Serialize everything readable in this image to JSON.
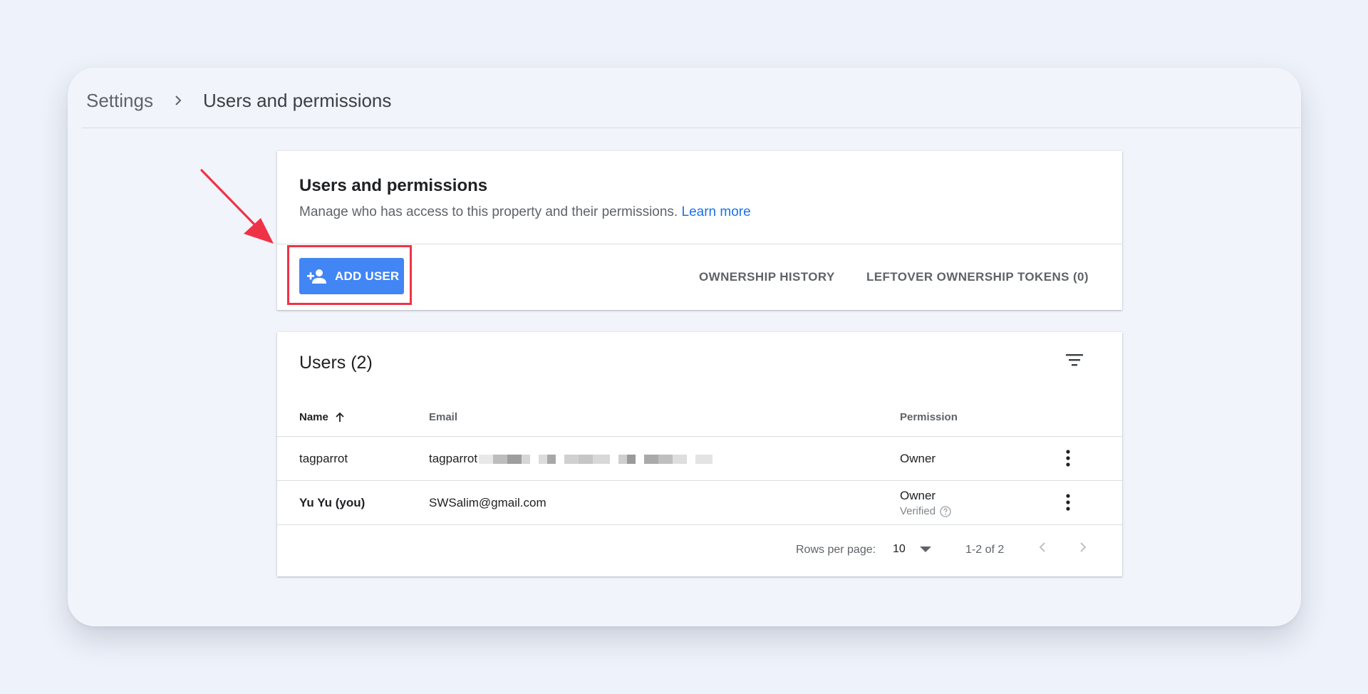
{
  "breadcrumb": {
    "root": "Settings",
    "current": "Users and permissions"
  },
  "header_card": {
    "title": "Users and permissions",
    "description": "Manage who has access to this property and their permissions.",
    "learn_more": "Learn more",
    "add_user_label": "ADD USER",
    "ownership_history_label": "OWNERSHIP HISTORY",
    "leftover_tokens_label": "LEFTOVER OWNERSHIP TOKENS (0)"
  },
  "users_card": {
    "title": "Users (2)",
    "columns": {
      "name": "Name",
      "email": "Email",
      "permission": "Permission"
    },
    "rows": [
      {
        "name": "tagparrot",
        "email": "tagparrot",
        "email_redacted": true,
        "permission": "Owner",
        "status": ""
      },
      {
        "name": "Yu Yu (you)",
        "email": "SWSalim@gmail.com",
        "email_redacted": false,
        "permission": "Owner",
        "status": "Verified"
      }
    ],
    "footer": {
      "rows_per_page_label": "Rows per page:",
      "rows_per_page_value": "10",
      "range": "1-2 of 2"
    }
  },
  "colors": {
    "accent": "#4285f4",
    "link": "#1a73e8",
    "highlight": "#ef3347"
  },
  "icons": [
    "chevron-right-icon",
    "person-add-icon",
    "filter-icon",
    "arrow-up-icon",
    "more-vert-icon",
    "help-icon",
    "dropdown-triangle-icon",
    "chevron-left-icon",
    "pointer-arrow-icon"
  ]
}
